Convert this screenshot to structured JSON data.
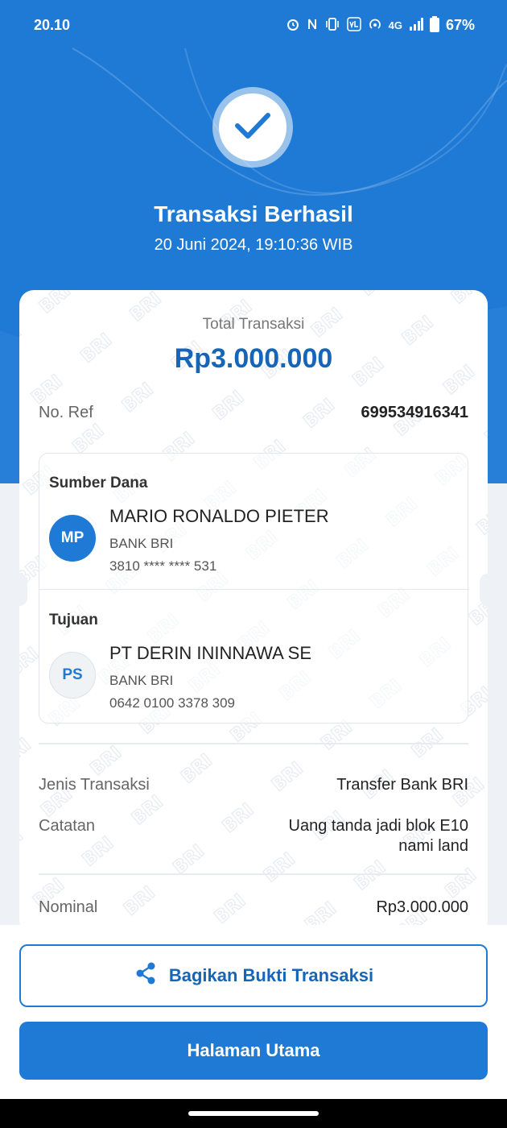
{
  "status_bar": {
    "time": "20.10",
    "network": "4G",
    "battery": "67%"
  },
  "header": {
    "title": "Transaksi Berhasil",
    "datetime": "20 Juni 2024, 19:10:36 WIB"
  },
  "receipt": {
    "total_label": "Total Transaksi",
    "total_amount": "Rp3.000.000",
    "ref_label": "No. Ref",
    "ref_value": "699534916341",
    "source": {
      "heading": "Sumber Dana",
      "initials": "MP",
      "name": "MARIO RONALDO PIETER",
      "bank": "BANK BRI",
      "account": "3810 **** **** 531"
    },
    "destination": {
      "heading": "Tujuan",
      "initials": "PS",
      "name": "PT DERIN ININNAWA SE",
      "bank": "BANK BRI",
      "account": "0642 0100 3378 309"
    },
    "type_label": "Jenis Transaksi",
    "type_value": "Transfer Bank BRI",
    "note_label": "Catatan",
    "note_line1": "Uang tanda jadi blok E10",
    "note_line2": "nami land",
    "nominal_label": "Nominal",
    "nominal_value": "Rp3.000.000"
  },
  "actions": {
    "share_label": "Bagikan Bukti Transaksi",
    "home_label": "Halaman Utama"
  },
  "colors": {
    "primary": "#1f7ad6",
    "primary_dark": "#1565b8"
  }
}
